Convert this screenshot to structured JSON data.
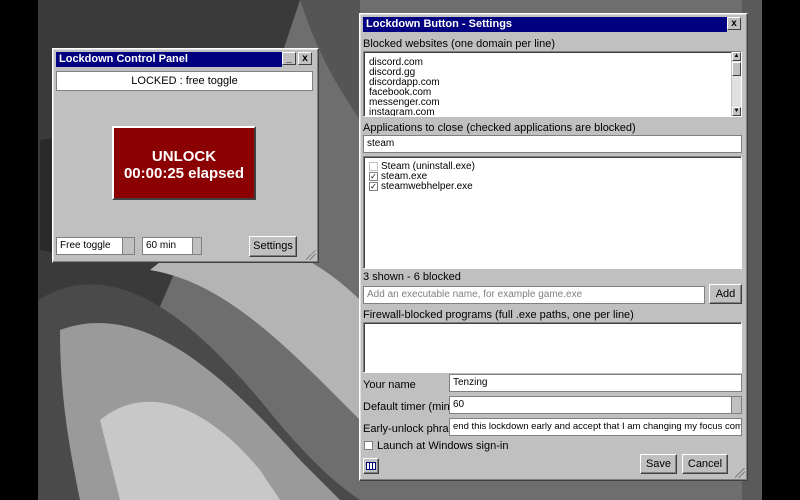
{
  "control_panel": {
    "title": "Lockdown Control Panel",
    "minimize_glyph": "_",
    "close_glyph": "x",
    "status_text": "LOCKED : free toggle",
    "big_button": {
      "line1": "UNLOCK",
      "line2": "00:00:25 elapsed",
      "color": "#8b0000"
    },
    "mode_select": "Free toggle",
    "duration_select": "60 min",
    "settings_button": "Settings"
  },
  "settings": {
    "title": "Lockdown Button - Settings",
    "close_glyph": "x",
    "blocked_websites_label": "Blocked websites (one domain per line)",
    "blocked_websites": [
      "discord.com",
      "discord.gg",
      "discordapp.com",
      "facebook.com",
      "messenger.com",
      "instagram.com"
    ],
    "apps_label": "Applications to close (checked applications are blocked)",
    "apps_filter_value": "steam",
    "apps": [
      {
        "label": "Steam  (uninstall.exe)",
        "checked": false
      },
      {
        "label": "steam.exe",
        "checked": true
      },
      {
        "label": "steamwebhelper.exe",
        "checked": true
      }
    ],
    "apps_summary": "3 shown - 6 blocked",
    "add_exe_placeholder": "Add an executable name, for example game.exe",
    "add_button": "Add",
    "firewall_label": "Firewall-blocked programs (full .exe paths, one per line)",
    "firewall_value": "",
    "your_name_label": "Your name",
    "your_name_value": "Tenzing",
    "default_timer_label": "Default timer (minutes)",
    "default_timer_value": "60",
    "early_unlock_label": "Early-unlock phrase",
    "early_unlock_value": "end this lockdown early and accept that I am changing my focus commitment.",
    "launch_label": "Launch at Windows sign-in",
    "launch_checked": false,
    "save_button": "Save",
    "cancel_button": "Cancel",
    "check_glyph": "✓",
    "calendar_icon": "calendar-icon"
  },
  "colors": {
    "titlebar": "#000080",
    "window": "#c0c0c0",
    "accent_red": "#8b0000"
  }
}
